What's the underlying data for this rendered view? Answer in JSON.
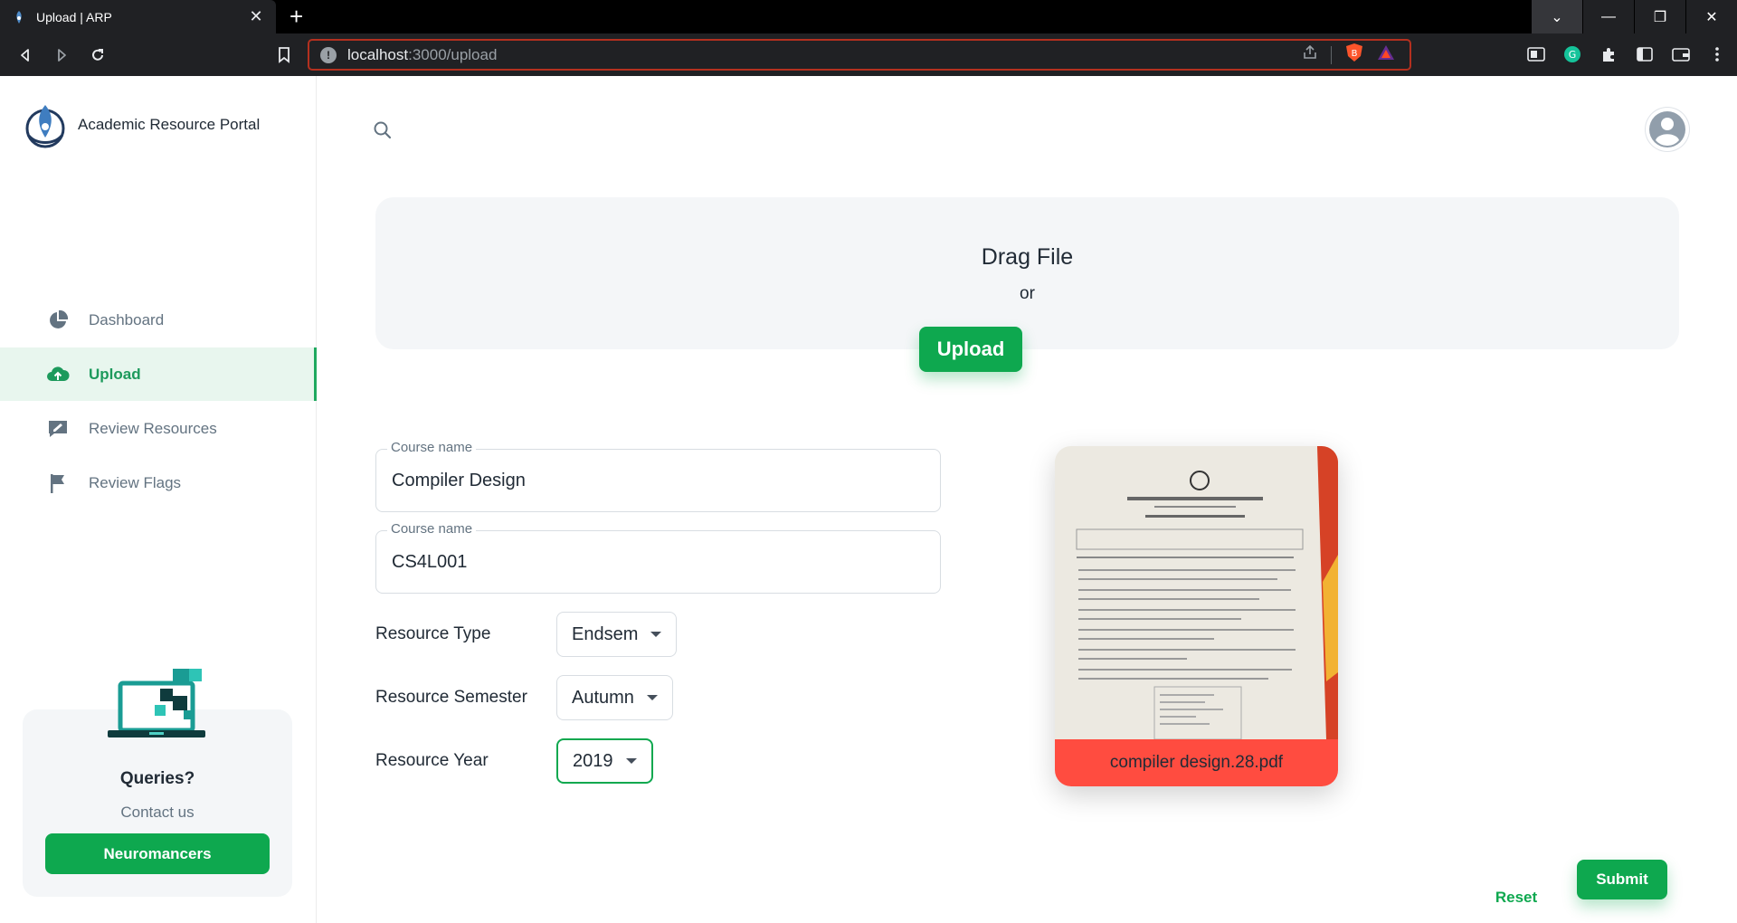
{
  "browser": {
    "tab_title": "Upload | ARP",
    "url_host": "localhost",
    "url_path": ":3000/upload",
    "icons": [
      "back-icon",
      "forward-icon",
      "reload-icon",
      "bookmark-icon",
      "info-icon",
      "share-icon",
      "brave-shield-icon",
      "brave-rewards-icon",
      "sidebar-icon",
      "grammarly-icon",
      "extensions-icon",
      "split-view-icon",
      "wallet-icon",
      "menu-icon"
    ],
    "brave_badge": "1"
  },
  "sidebar": {
    "brand": "Academic Resource Portal",
    "items": [
      {
        "label": "Dashboard",
        "icon": "pie-chart-icon"
      },
      {
        "label": "Upload",
        "icon": "cloud-upload-icon"
      },
      {
        "label": "Review Resources",
        "icon": "review-icon"
      },
      {
        "label": "Review Flags",
        "icon": "flag-icon"
      }
    ],
    "query": {
      "title": "Queries?",
      "subtitle": "Contact us",
      "button": "Neuromancers"
    }
  },
  "upload": {
    "drag_text": "Drag File",
    "or_text": "or",
    "upload_button": "Upload"
  },
  "form": {
    "course_name_label": "Course name",
    "course_name_value": "Compiler Design",
    "course_code_label": "Course name",
    "course_code_value": "CS4L001",
    "resource_type_label": "Resource Type",
    "resource_type_value": "Endsem",
    "resource_semester_label": "Resource Semester",
    "resource_semester_value": "Autumn",
    "resource_year_label": "Resource Year",
    "resource_year_value": "2019"
  },
  "preview": {
    "filename": "compiler design.28.pdf"
  },
  "actions": {
    "reset": "Reset",
    "submit": "Submit"
  },
  "colors": {
    "accent": "#0ea84f",
    "active_bg": "#e8f6ee",
    "file_bar": "#ff4c40"
  }
}
